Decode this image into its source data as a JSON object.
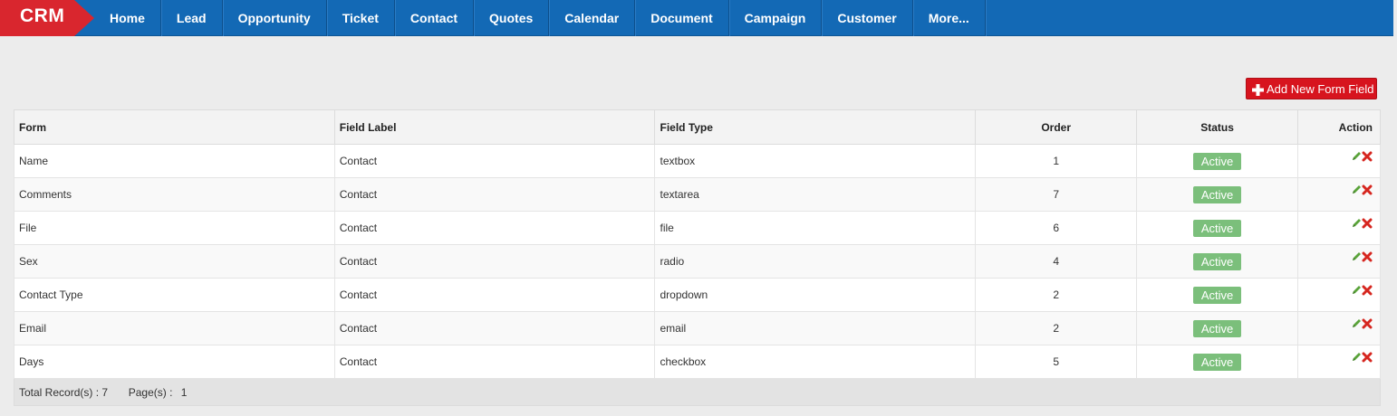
{
  "brand": {
    "name": "CRM",
    "color": "#d9262e"
  },
  "nav": {
    "items": [
      "Home",
      "Lead",
      "Opportunity",
      "Ticket",
      "Contact",
      "Quotes",
      "Calendar",
      "Document",
      "Campaign",
      "Customer",
      "More..."
    ]
  },
  "toolbar": {
    "add_label": "Add New Form Field",
    "add_icon": "plus-icon"
  },
  "table": {
    "headers": {
      "form": "Form",
      "label": "Field Label",
      "type": "Field Type",
      "order": "Order",
      "status": "Status",
      "action": "Action"
    },
    "rows": [
      {
        "form": "Name",
        "label": "Contact",
        "type": "textbox",
        "order": "1",
        "status": "Active"
      },
      {
        "form": "Comments",
        "label": "Contact",
        "type": "textarea",
        "order": "7",
        "status": "Active"
      },
      {
        "form": "File",
        "label": "Contact",
        "type": "file",
        "order": "6",
        "status": "Active"
      },
      {
        "form": "Sex",
        "label": "Contact",
        "type": "radio",
        "order": "4",
        "status": "Active"
      },
      {
        "form": "Contact Type",
        "label": "Contact",
        "type": "dropdown",
        "order": "2",
        "status": "Active"
      },
      {
        "form": "Email",
        "label": "Contact",
        "type": "email",
        "order": "2",
        "status": "Active"
      },
      {
        "form": "Days",
        "label": "Contact",
        "type": "checkbox",
        "order": "5",
        "status": "Active"
      }
    ],
    "footer": {
      "total_label": "Total Record(s) :",
      "total_value": "7",
      "pages_label": "Page(s) :",
      "pages_value": "1"
    }
  },
  "colors": {
    "nav_bg": "#1369b5",
    "accent_red": "#d7141e",
    "status_green": "#7bbf7b"
  }
}
